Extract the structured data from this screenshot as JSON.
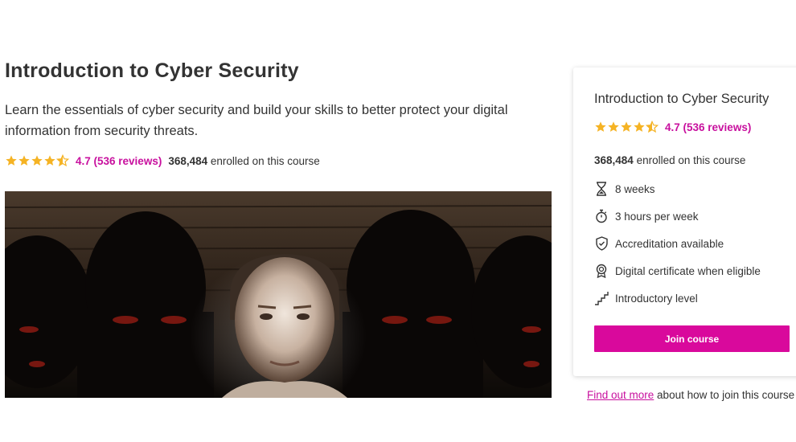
{
  "course": {
    "title": "Introduction to Cyber Security",
    "description": "Learn the essentials of cyber security and build your skills to better protect your digital information from security threats.",
    "rating_value": 4.7,
    "rating_text": "4.7 (536 reviews)",
    "enrolled_count": "368,484",
    "enrolled_suffix": " enrolled on this course"
  },
  "card": {
    "title": "Introduction to Cyber Security",
    "rating_text": "4.7 (536 reviews)",
    "enrolled_count": "368,484",
    "enrolled_suffix": " enrolled on this course",
    "features": [
      {
        "icon": "hourglass-icon",
        "label": "8 weeks"
      },
      {
        "icon": "stopwatch-icon",
        "label": "3 hours per week"
      },
      {
        "icon": "shield-check-icon",
        "label": "Accreditation available"
      },
      {
        "icon": "certificate-badge-icon",
        "label": "Digital certificate when eligible"
      },
      {
        "icon": "steps-icon",
        "label": "Introductory level"
      }
    ],
    "join_label": "Join course"
  },
  "footer": {
    "find_out_link": "Find out more",
    "find_out_rest": " about how to join this course"
  },
  "colors": {
    "accent": "#d9099c",
    "link": "#c8109e",
    "star": "#f5b324"
  }
}
